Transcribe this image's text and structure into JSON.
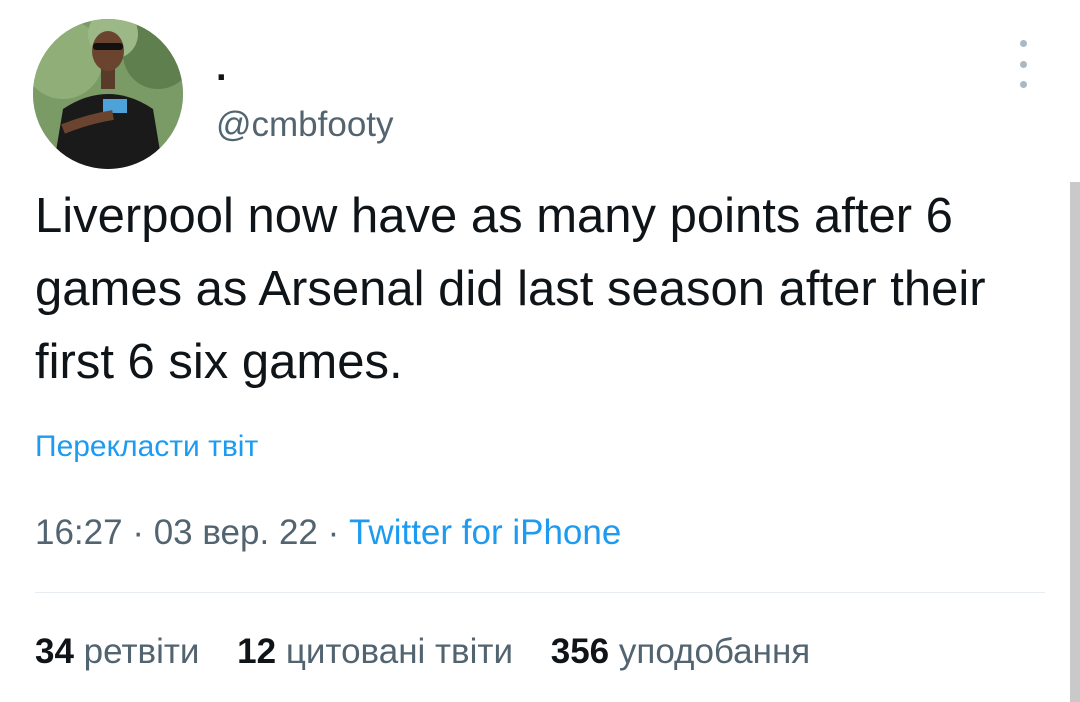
{
  "author": {
    "display_name": ".",
    "handle": "@cmbfooty"
  },
  "tweet": {
    "text": "Liverpool now have as many points after 6 games as Arsenal did last season after their first 6 six games.",
    "translate_label": "Перекласти твіт",
    "time": "16:27",
    "separator": " · ",
    "date": "03 вер. 22",
    "source": "Twitter for iPhone"
  },
  "stats": {
    "retweets_count": "34",
    "retweets_label": "ретвіти",
    "quotes_count": "12",
    "quotes_label": "цитовані твіти",
    "likes_count": "356",
    "likes_label": "уподобання"
  },
  "icons": {
    "more": "more-options-icon"
  },
  "colors": {
    "link": "#1d9bf0",
    "secondary_text": "#536471",
    "primary_text": "#0f1419"
  }
}
